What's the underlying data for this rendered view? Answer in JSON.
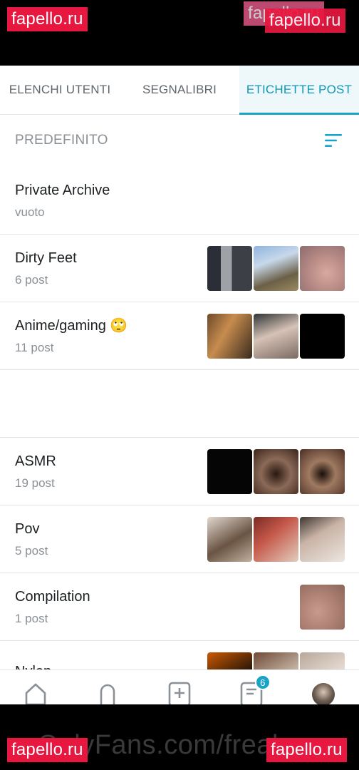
{
  "watermarks": {
    "top_left": "fapello.ru",
    "top_right": "fapello.ru",
    "top_right_ghost": "fapello.ru",
    "bottom_left": "fapello.ru",
    "bottom_right": "fapello.ru",
    "bottom_center": "OnlyFans.com/freaky..."
  },
  "tabs": [
    {
      "label": "ELENCHI UTENTI"
    },
    {
      "label": "SEGNALIBRI"
    },
    {
      "label": "ETICHETTE POST"
    }
  ],
  "section": {
    "title": "PREDEFINITO"
  },
  "rows": [
    {
      "name": "Private Archive",
      "count": "vuoto"
    },
    {
      "name": "Dirty Feet",
      "count": "6 post"
    },
    {
      "name": "Anime/gaming 🙄",
      "count": "11 post"
    },
    {
      "name": "ASMR",
      "count": "19 post"
    },
    {
      "name": "Pov",
      "count": "5 post"
    },
    {
      "name": "Compilation",
      "count": "1 post"
    },
    {
      "name": "Nylon",
      "count": ""
    }
  ],
  "bottom_nav": {
    "items": [
      "home-icon",
      "notifications-icon",
      "add-icon",
      "lists-icon",
      "avatar"
    ],
    "badge": "6"
  },
  "colors": {
    "accent": "#19a3c6",
    "watermark": "#e8173f"
  }
}
